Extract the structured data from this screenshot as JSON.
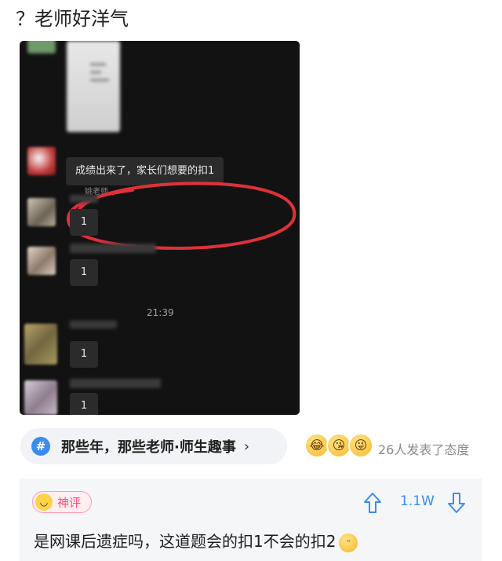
{
  "post": {
    "title": "？老师好洋气"
  },
  "chat": {
    "sender_name": "姚老师",
    "teacher_message": "成绩出来了，家长们想要的扣1",
    "replies": [
      "1",
      "1",
      "1",
      "1"
    ],
    "timestamp": "21:39"
  },
  "topic": {
    "hash": "#",
    "label": "那些年，那些老师·师生趣事",
    "chevron": "›"
  },
  "reactions": {
    "count_text": "26人发表了态度"
  },
  "comment": {
    "badge": "神评",
    "votes": "1.1W",
    "text": "是网课后遗症吗，这道题会的扣1不会的扣2"
  },
  "colors": {
    "accent": "#3b8cf0",
    "hot_pink": "#ff4f79",
    "ellipse_red": "#e0303a"
  },
  "icons": [
    "hash-icon",
    "chevron-right-icon",
    "laugh-cry-emoji",
    "kiss-emoji",
    "wink-tongue-emoji",
    "smile-face-icon",
    "upvote-arrow-icon",
    "downvote-arrow-icon",
    "grin-emoji"
  ]
}
